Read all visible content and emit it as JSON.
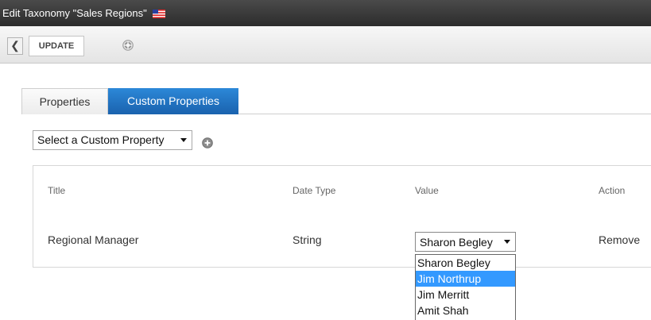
{
  "window": {
    "title": "Edit Taxonomy \"Sales Regions\"",
    "flag_icon": "us-flag-icon"
  },
  "toolbar": {
    "back_icon": "chevron-left-icon",
    "back_glyph": "❮",
    "update_label": "UPDATE",
    "help_icon": "help-icon"
  },
  "tabs": [
    {
      "label": "Properties",
      "active": false
    },
    {
      "label": "Custom Properties",
      "active": true
    }
  ],
  "custom_property_select": {
    "value": "Select a Custom Property",
    "add_icon": "add-circle-icon"
  },
  "table": {
    "headers": [
      "Title",
      "Date Type",
      "Value",
      "Action"
    ],
    "rows": [
      {
        "title": "Regional Manager",
        "data_type": "String",
        "value": "Sharon Begley",
        "action": "Remove"
      }
    ]
  },
  "value_dropdown": {
    "options": [
      "Sharon Begley",
      "Jim Northrup",
      "Jim Merritt",
      "Amit Shah"
    ],
    "highlighted": "Jim Northrup"
  },
  "colors": {
    "titlebar_bg": "#2c2c2c",
    "active_tab_bg": "#1a62ae",
    "highlight_bg": "#3399ff"
  }
}
